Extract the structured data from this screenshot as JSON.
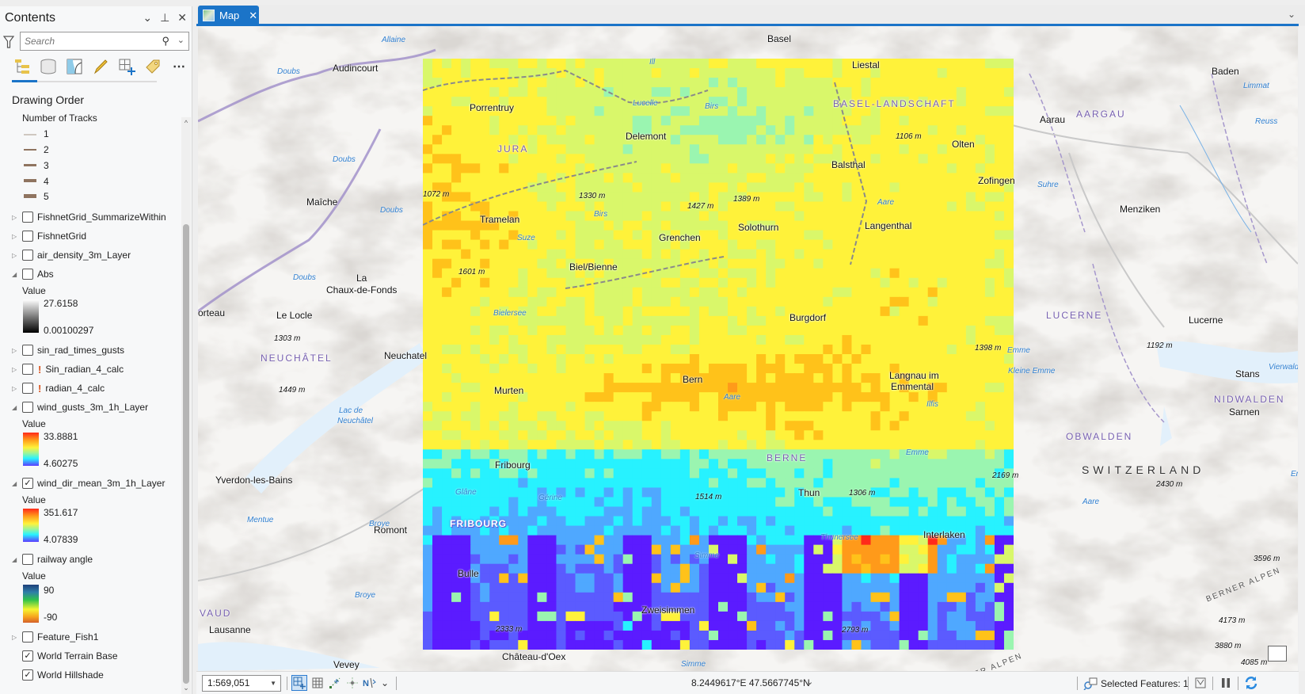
{
  "contents": {
    "title": "Contents",
    "search_placeholder": "Search",
    "drawing_order": "Drawing Order",
    "tracks_legend": {
      "title": "Number of Tracks",
      "items": [
        "1",
        "2",
        "3",
        "4",
        "5"
      ]
    },
    "layers": [
      {
        "name": "FishnetGrid_SummarizeWithin",
        "checked": false,
        "expanded": false
      },
      {
        "name": "FishnetGrid",
        "checked": false,
        "expanded": false
      },
      {
        "name": "air_density_3m_Layer",
        "checked": false,
        "expanded": false
      },
      {
        "name": "Abs",
        "checked": false,
        "expanded": true,
        "legend": {
          "title": "Value",
          "high": "27.6158",
          "low": "0.00100297"
        }
      },
      {
        "name": "sin_rad_times_gusts",
        "checked": false,
        "expanded": false
      },
      {
        "name": "Sin_radian_4_calc",
        "checked": false,
        "expanded": false,
        "warning": true
      },
      {
        "name": "radian_4_calc",
        "checked": false,
        "expanded": false,
        "warning": true
      },
      {
        "name": "wind_gusts_3m_1h_Layer",
        "checked": false,
        "expanded": true,
        "legend": {
          "title": "Value",
          "high": "33.8881",
          "low": "4.60275"
        }
      },
      {
        "name": "wind_dir_mean_3m_1h_Layer",
        "checked": true,
        "expanded": true,
        "legend": {
          "title": "Value",
          "high": "351.617",
          "low": "4.07839"
        }
      },
      {
        "name": "railway angle",
        "checked": false,
        "expanded": true,
        "legend": {
          "title": "Value",
          "high": "90",
          "low": "-90"
        }
      },
      {
        "name": "Feature_Fish1",
        "checked": false,
        "expanded": false
      },
      {
        "name": "World Terrain Base",
        "checked": true
      },
      {
        "name": "World Hillshade",
        "checked": true
      }
    ],
    "warning_glyph": "!",
    "check_glyph": "✓"
  },
  "map": {
    "tab_label": "Map",
    "close_glyph": "✕",
    "labels": {
      "cities": [
        {
          "text": "Basel"
        },
        {
          "text": "Liestal"
        },
        {
          "text": "Audincourt"
        },
        {
          "text": "Porrentruy"
        },
        {
          "text": "Delemont"
        },
        {
          "text": "Baden"
        },
        {
          "text": "Aarau"
        },
        {
          "text": "Olten"
        },
        {
          "text": "Balsthal"
        },
        {
          "text": "Zofingen"
        },
        {
          "text": "Maîche"
        },
        {
          "text": "Tramelan"
        },
        {
          "text": "Grenchen"
        },
        {
          "text": "Solothurn"
        },
        {
          "text": "Langenthal"
        },
        {
          "text": "Menziken"
        },
        {
          "text": "La"
        },
        {
          "text": "Chaux-de-Fonds"
        },
        {
          "text": "Biel/Bienne"
        },
        {
          "text": "orteau"
        },
        {
          "text": "Le Locle"
        },
        {
          "text": "Burgdorf"
        },
        {
          "text": "Lucerne"
        },
        {
          "text": "Neuchatel"
        },
        {
          "text": "Bern"
        },
        {
          "text": "Langnau im"
        },
        {
          "text": "Emmental"
        },
        {
          "text": "Murten"
        },
        {
          "text": "Stans"
        },
        {
          "text": "Sarnen"
        },
        {
          "text": "Fribourg"
        },
        {
          "text": "Yverdon-les-Bains"
        },
        {
          "text": "Thun"
        },
        {
          "text": "Romont"
        },
        {
          "text": "Interlaken"
        },
        {
          "text": "Bulle"
        },
        {
          "text": "Zweisimmen"
        },
        {
          "text": "Lausanne"
        },
        {
          "text": "Vevey"
        },
        {
          "text": "Château-d'Oex"
        }
      ],
      "regions": [
        "JURA",
        "BASEL-LANDSCHAFT",
        "AARGAU",
        "LUCERNE",
        "NEUCHÂTEL",
        "NIDWALDEN",
        "BERNE",
        "OBWALDEN",
        "VAUD",
        "FRIBOURG"
      ],
      "country": "SWITZERLAND",
      "elevations": [
        "1106 m",
        "1072 m",
        "1330 m",
        "1427 m",
        "1389 m",
        "1601 m",
        "1303 m",
        "1398 m",
        "1192 m",
        "1449 m",
        "2169 m",
        "2430 m",
        "1514 m",
        "1306 m",
        "3596 m",
        "2333 m",
        "2793 m",
        "4173 m",
        "3880 m",
        "4085 m"
      ],
      "water": [
        "Allaine",
        "Doubs",
        "Lucelle",
        "Birs",
        "Ill",
        "Limmat",
        "Reuss",
        "Doubs",
        "Doubs",
        "Birs",
        "Suze",
        "Aare",
        "Suhre",
        "Doubs",
        "Bielersee",
        "Emme",
        "Kleine Emme",
        "Vierwaldstätters",
        "Aare",
        "Ilfis",
        "Lac de",
        "Neuchâtel",
        "Emme",
        "Glâne",
        "Gérine",
        "Broye",
        "Mentue",
        "Thunersee",
        "Simme",
        "Broye",
        "Engelb",
        "Aare",
        "Simme",
        "BERNER ALPEN",
        "BERNER ALPEN"
      ]
    }
  },
  "statusbar": {
    "scale": "1:569,051",
    "coordinates": "8.2449617°E 47.5667745°N",
    "selected_features": "Selected Features: 1"
  }
}
